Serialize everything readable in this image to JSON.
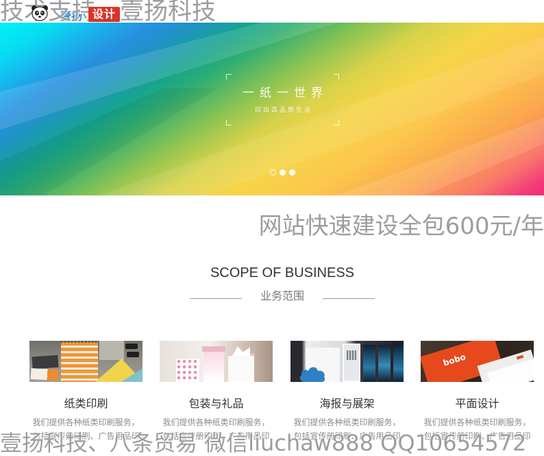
{
  "watermarks": {
    "top": "技术支持　壹扬科技",
    "middle": "网站快速建设全包600元/年",
    "bottom": "壹扬科技、八条贸易 微信liuchaw888 QQ10654572"
  },
  "header": {
    "logo_icon": "panda-icon",
    "logo_name": "壹扬",
    "logo_badge": "设计"
  },
  "banner": {
    "title": "一纸一世界",
    "subtitle": "印出高品质生活",
    "slide_count": 3,
    "active_slide": 1
  },
  "business": {
    "title_en": "SCOPE OF BUSINESS",
    "title_cn": "业务范围",
    "items": [
      {
        "title": "纸类印刷",
        "desc_lines": [
          "我们提供各种纸类印刷服务，",
          "包括宣传册印刷、广告用品印"
        ]
      },
      {
        "title": "包装与礼品",
        "desc_lines": [
          "我们提供各种纸类印刷服务，",
          "包括宣传册印刷、广告用品印"
        ]
      },
      {
        "title": "海报与展架",
        "desc_lines": [
          "我们提供各种纸类印刷服务，",
          "包括宣传册印刷、广告用品印"
        ]
      },
      {
        "title": "平面设计",
        "desc_lines": [
          "我们提供各种纸类印刷服务，",
          "包括宣传册印刷、广告用品印"
        ],
        "image_text": "bobo"
      }
    ]
  },
  "colors": {
    "logo_badge": "#d9342b",
    "logo_name": "#2c86cc",
    "heading": "#333333",
    "subheading": "#777777",
    "body_text": "#8a8a8a",
    "rule": "#9a9a9a"
  }
}
